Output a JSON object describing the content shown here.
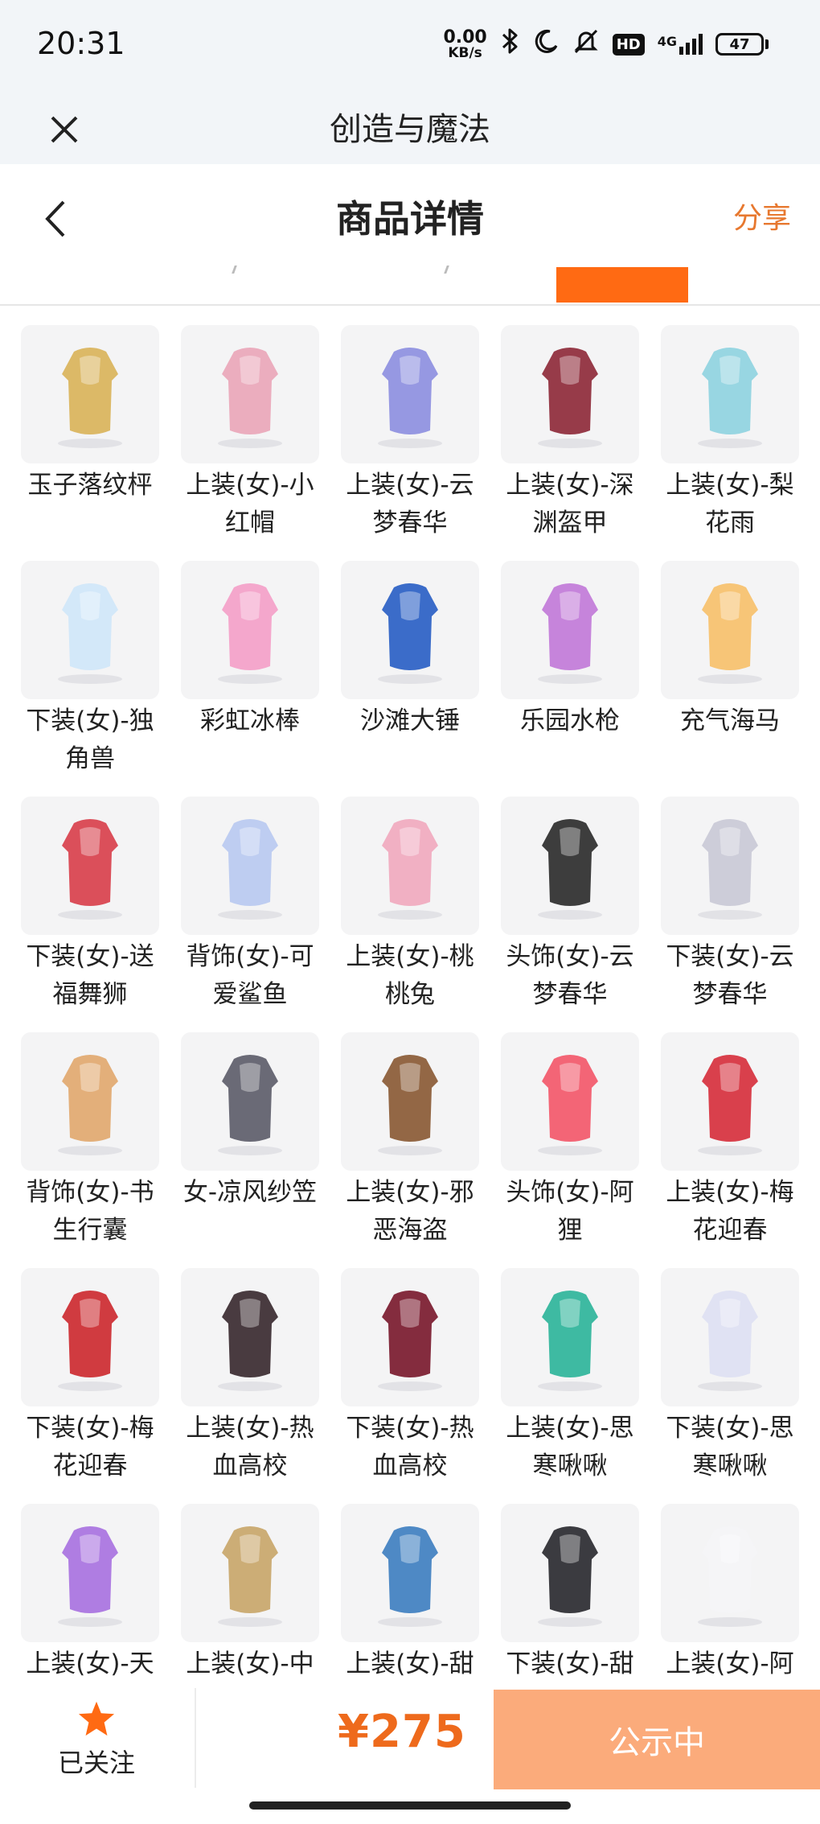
{
  "status_bar": {
    "time": "20:31",
    "speed_value": "0.00",
    "speed_unit": "KB/s",
    "hd": "HD",
    "network": "4G",
    "battery": "47"
  },
  "mini_program": {
    "title": "创造与魔法",
    "close_icon": "close-icon"
  },
  "header": {
    "title": "商品详情",
    "share": "分享",
    "back_icon": "chevron-left-icon"
  },
  "items": [
    {
      "name": "玉子落纹枰",
      "color": "#d9b35a"
    },
    {
      "name": "上装(女)-小红帽",
      "color": "#e9a6b8"
    },
    {
      "name": "上装(女)-云梦春华",
      "color": "#8d8fe0"
    },
    {
      "name": "上装(女)-深渊盔甲",
      "color": "#8e2a3a"
    },
    {
      "name": "上装(女)-梨花雨",
      "color": "#8fd3df"
    },
    {
      "name": "下装(女)-独角兽",
      "color": "#cfe6f8"
    },
    {
      "name": "彩虹冰棒",
      "color": "#f3a0c8"
    },
    {
      "name": "沙滩大锤",
      "color": "#2a5fc4"
    },
    {
      "name": "乐园水枪",
      "color": "#c17ad8"
    },
    {
      "name": "充气海马",
      "color": "#f6c06b"
    },
    {
      "name": "下装(女)-送福舞狮",
      "color": "#d8404c"
    },
    {
      "name": "背饰(女)-可爱鲨鱼",
      "color": "#b9c9f0"
    },
    {
      "name": "上装(女)-桃桃兔",
      "color": "#f0a9be"
    },
    {
      "name": "头饰(女)-云梦春华",
      "color": "#2d2d2d"
    },
    {
      "name": "下装(女)-云梦春华",
      "color": "#c9c9d6"
    },
    {
      "name": "背饰(女)-书生行囊",
      "color": "#e1a86f"
    },
    {
      "name": "女-凉风纱笠",
      "color": "#5d5d6a"
    },
    {
      "name": "上装(女)-邪恶海盗",
      "color": "#8a5a35"
    },
    {
      "name": "头饰(女)-阿狸",
      "color": "#f2586a"
    },
    {
      "name": "上装(女)-梅花迎春",
      "color": "#d6303d"
    },
    {
      "name": "下装(女)-梅花迎春",
      "color": "#cc2a30"
    },
    {
      "name": "上装(女)-热血高校",
      "color": "#3a2a30"
    },
    {
      "name": "下装(女)-热血高校",
      "color": "#7a1a2e"
    },
    {
      "name": "上装(女)-思寒啾啾",
      "color": "#2eb49a"
    },
    {
      "name": "下装(女)-思寒啾啾",
      "color": "#dde0f2"
    },
    {
      "name": "上装(女)-天",
      "color": "#a872e0"
    },
    {
      "name": "上装(女)-中",
      "color": "#c8a66a"
    },
    {
      "name": "上装(女)-甜",
      "color": "#3f7fc0"
    },
    {
      "name": "下装(女)-甜",
      "color": "#2a2a30"
    },
    {
      "name": "上装(女)-阿",
      "color": "#f4f4f6"
    }
  ],
  "bottom_bar": {
    "follow_label": "已关注",
    "price": "¥275",
    "status_button": "公示中"
  },
  "colors": {
    "accent": "#ff6a13",
    "price": "#ee6a1c",
    "status_button": "#fbab7b",
    "star": "#ff6a13"
  }
}
